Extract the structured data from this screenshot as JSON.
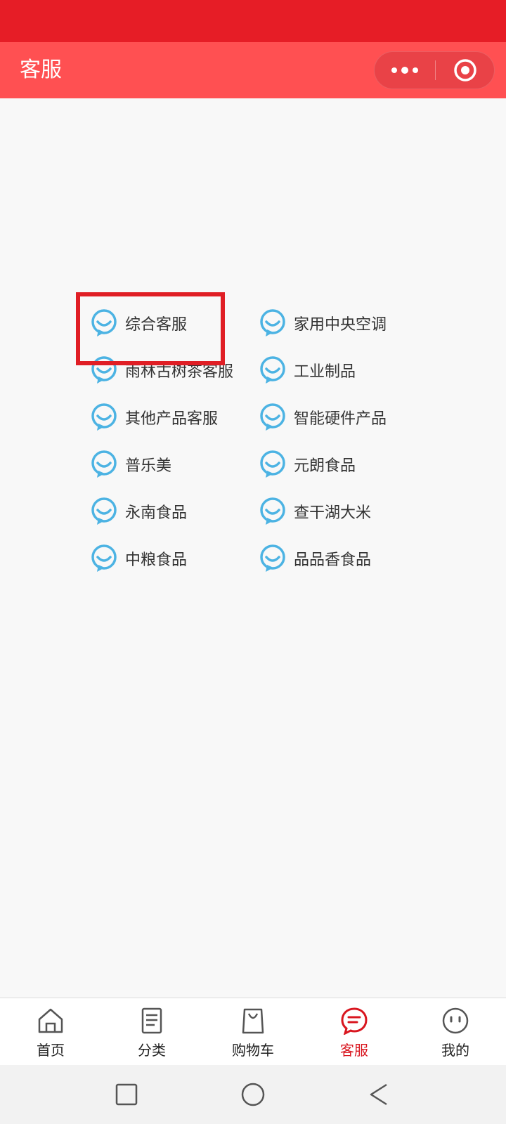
{
  "header": {
    "title": "客服"
  },
  "services": {
    "left": [
      "综合客服",
      "雨林古树茶客服",
      "其他产品客服",
      "普乐美",
      "永南食品",
      "中粮食品"
    ],
    "right": [
      "家用中央空调",
      "工业制品",
      "智能硬件产品",
      "元朗食品",
      "查干湖大米",
      "品品香食品"
    ]
  },
  "tabs": [
    {
      "label": "首页",
      "icon": "home-icon"
    },
    {
      "label": "分类",
      "icon": "category-icon"
    },
    {
      "label": "购物车",
      "icon": "cart-icon"
    },
    {
      "label": "客服",
      "icon": "service-chat-icon"
    },
    {
      "label": "我的",
      "icon": "profile-icon"
    }
  ],
  "active_tab": "客服",
  "colors": {
    "status_bar": "#e61d26",
    "title_bar": "#ff5052",
    "service_icon": "#4cb3e3",
    "highlight_box": "#e01e25",
    "active_tab": "#d9161f"
  }
}
